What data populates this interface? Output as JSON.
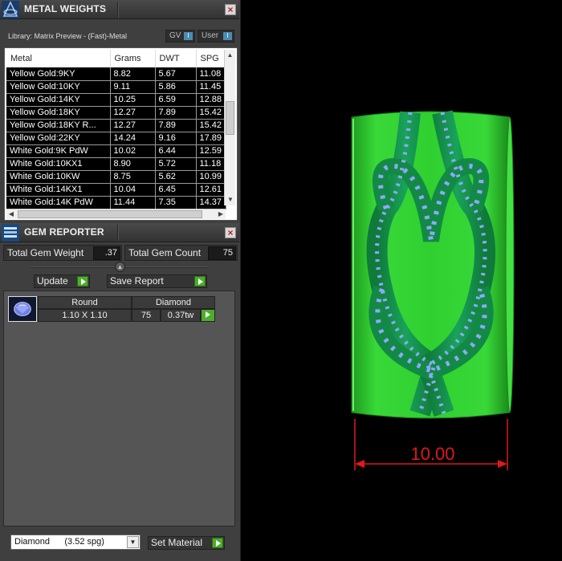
{
  "metal_weights": {
    "title": "METAL WEIGHTS",
    "close": "×",
    "library_label": "Library: Matrix Preview - (Fast)-Metal",
    "gv_label": "GV",
    "user_label": "User",
    "toggle_indicator": "I",
    "columns": [
      "Metal",
      "Grams",
      "DWT",
      "SPG"
    ],
    "rows": [
      [
        "Yellow Gold:9KY",
        "8.82",
        "5.67",
        "11.08"
      ],
      [
        "Yellow Gold:10KY",
        "9.11",
        "5.86",
        "11.45"
      ],
      [
        "Yellow Gold:14KY",
        "10.25",
        "6.59",
        "12.88"
      ],
      [
        "Yellow Gold:18KY",
        "12.27",
        "7.89",
        "15.42"
      ],
      [
        "Yellow Gold:18KY R...",
        "12.27",
        "7.89",
        "15.42"
      ],
      [
        "Yellow Gold:22KY",
        "14.24",
        "9.16",
        "17.89"
      ],
      [
        "White Gold:9K PdW",
        "10.02",
        "6.44",
        "12.59"
      ],
      [
        "White Gold:10KX1",
        "8.90",
        "5.72",
        "11.18"
      ],
      [
        "White Gold:10KW",
        "8.75",
        "5.62",
        "10.99"
      ],
      [
        "White Gold:14KX1",
        "10.04",
        "6.45",
        "12.61"
      ],
      [
        "White Gold:14K PdW",
        "11.44",
        "7.35",
        "14.37"
      ]
    ],
    "scroll_up": "▲",
    "scroll_down": "▼",
    "scroll_left": "◀",
    "scroll_right": "▶"
  },
  "gem_reporter": {
    "title": "GEM REPORTER",
    "close": "×",
    "total_gem_weight_label": "Total Gem Weight",
    "total_gem_weight_value": ".37",
    "total_gem_count_label": "Total Gem Count",
    "total_gem_count_value": "75",
    "slider_glyph": "▲",
    "update_label": "Update",
    "save_report_label": "Save Report",
    "gems": [
      {
        "shape": "Round",
        "material": "Diamond",
        "size": "1.10 X 1.10",
        "count": "75",
        "weight": "0.37tw"
      }
    ],
    "material_select": "Diamond      (3.52 spg)",
    "dropdown_glyph": "▼",
    "set_material_label": "Set Material"
  },
  "viewport": {
    "dimension_label": "10.00",
    "colors": {
      "ring_green": "#2fd02f",
      "gem_blue": "#8fa8ff",
      "dimension_red": "#e01818"
    }
  }
}
